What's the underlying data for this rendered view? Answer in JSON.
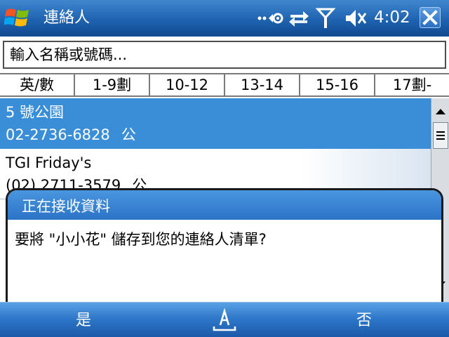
{
  "titlebar": {
    "app_title": "連絡人",
    "clock": "4:02",
    "icons": [
      "windows-logo-icon",
      "connectivity-icon",
      "sync-arrows-icon",
      "signal-icon",
      "speaker-muted-icon",
      "close-icon"
    ]
  },
  "search": {
    "placeholder": "輸入名稱或號碼..."
  },
  "tabs": [
    {
      "label": "英/數"
    },
    {
      "label": "1-9劃"
    },
    {
      "label": "10-12"
    },
    {
      "label": "13-14"
    },
    {
      "label": "15-16"
    },
    {
      "label": "17劃-"
    }
  ],
  "contacts": [
    {
      "name": "5 號公園",
      "phone": "02-2736-6828",
      "type": "公",
      "selected": true
    },
    {
      "name": "TGI Friday's",
      "phone": "(02) 2711-3579",
      "type": "公",
      "selected": false
    }
  ],
  "dialog": {
    "title": "正在接收資料",
    "message": "要將 \"小小花\" 儲存到您的連絡人清單?"
  },
  "menubar": {
    "left_softkey": "是",
    "right_softkey": "否",
    "input_icon": "keyboard-input-icon"
  },
  "colors": {
    "titlebar": "#1f63b0",
    "selected_row": "#3a8ed8",
    "dialog_header": "#2b74c6",
    "menubar": "#2f78c9"
  }
}
